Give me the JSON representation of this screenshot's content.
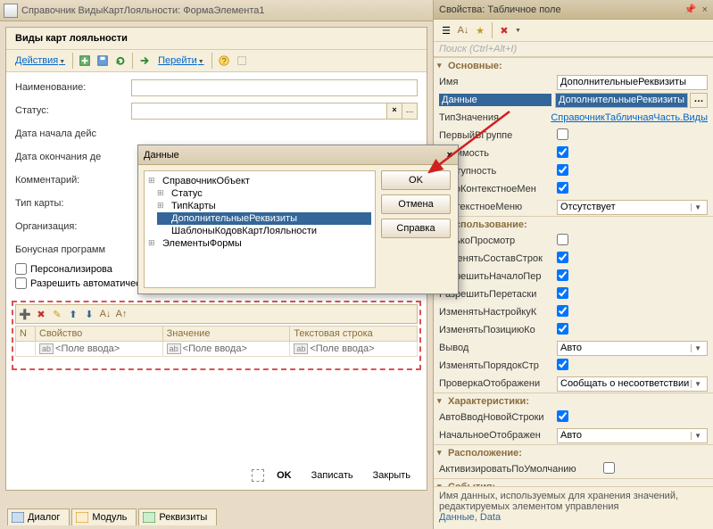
{
  "form": {
    "window_title": "Справочник ВидыКартЛояльности: ФормаЭлемента1",
    "header": "Виды карт лояльности",
    "actions_label": "Действия",
    "goto_label": "Перейти",
    "fields": {
      "name_label": "Наименование:",
      "status_label": "Статус:",
      "date_start_label": "Дата начала дейс",
      "date_end_label": "Дата окончания де",
      "comment_label": "Комментарий:",
      "card_type_label": "Тип карты:",
      "org_label": "Организация:",
      "bonus_label": "Бонусная программ"
    },
    "checkboxes": {
      "personalized": "Персонализирова",
      "autoreg": "Разрешить автоматическую регистрацию при первом считывании"
    },
    "table": {
      "headers": [
        "N",
        "Свойство",
        "Значение",
        "Текстовая строка"
      ],
      "placeholder": "<Поле ввода>"
    },
    "footer": {
      "ok": "OK",
      "save": "Записать",
      "close": "Закрыть"
    },
    "bottom_tabs": [
      "Диалог",
      "Модуль",
      "Реквизиты"
    ]
  },
  "dialog": {
    "title": "Данные",
    "tree_root": "СправочникОбъект",
    "tree_items": [
      "Статус",
      "ТипКарты",
      "ДополнительныеРеквизиты",
      "ШаблоныКодовКартЛояльности",
      "ЭлементыФормы"
    ],
    "selected_index": 2,
    "buttons": {
      "ok": "OK",
      "cancel": "Отмена",
      "help": "Справка"
    }
  },
  "props": {
    "panel_title": "Свойства: Табличное поле",
    "search_placeholder": "Поиск (Ctrl+Alt+I)",
    "sections": {
      "basic": "Основные:",
      "usage": "Использование:",
      "char": "Характеристики:",
      "layout": "Расположение:",
      "events": "События:"
    },
    "basic": {
      "name_label": "Имя",
      "name_value": "ДополнительныеРеквизиты",
      "data_label": "Данные",
      "data_value": "ДополнительныеРеквизиты",
      "type_label": "ТипЗначения",
      "type_value": "СправочникТабличнаяЧасть.Виды",
      "first_in_group": "ПервыйВГруппе",
      "visibility": "Видимость",
      "accessibility": "Доступность",
      "autocontext": "АвтоКонтекстноеМен",
      "contextmenu_label": "КонтекстноеМеню",
      "contextmenu_value": "Отсутствует"
    },
    "usage": {
      "readonly": "ТолькоПросмотр",
      "change_rows": "ИзменятьСоставСтрок",
      "allow_begin": "РазрешитьНачалоПер",
      "allow_drag": "РазрешитьПеретаски",
      "change_settings": "ИзменятьНастройкуК",
      "change_pos": "ИзменятьПозициюКо",
      "output_label": "Вывод",
      "output_value": "Авто",
      "change_order": "ИзменятьПорядокСтр",
      "check_display_label": "ПроверкаОтображени",
      "check_display_value": "Сообщать о несоответствии"
    },
    "char": {
      "autonewline": "АвтоВводНовойСтроки",
      "firstdisplay_label": "НачальноеОтображен",
      "firstdisplay_value": "Авто"
    },
    "layout": {
      "activate_default": "АктивизироватьПоУмолчанию"
    },
    "footer": {
      "desc": "Имя данных, используемых для хранения значений, редактируемых элементом управления",
      "link": "Данные, Data"
    }
  }
}
